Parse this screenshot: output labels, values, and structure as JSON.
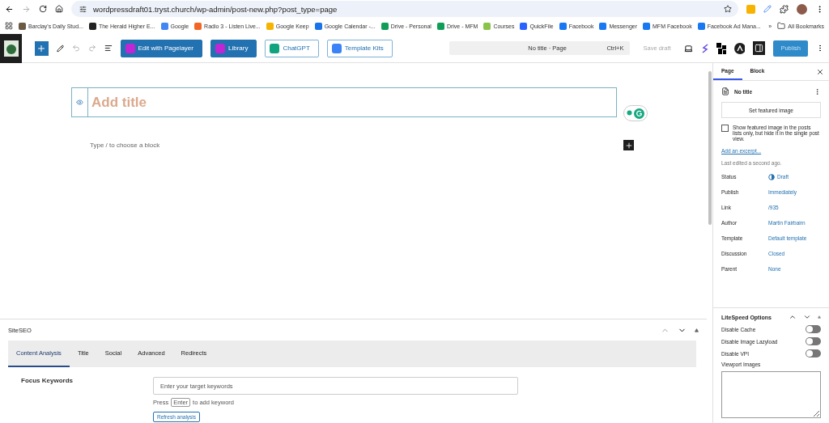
{
  "browser": {
    "url": "wordpressdraft01.tryst.church/wp-admin/post-new.php?post_type=page",
    "bookmarks": [
      {
        "label": "Barclay's Daily Stud...",
        "color": "#6b5a44"
      },
      {
        "label": "The Herald Higher E...",
        "color": "#222222"
      },
      {
        "label": "Google",
        "color": "#4285f4"
      },
      {
        "label": "Radio 3 - Listen Live...",
        "color": "#f26522"
      },
      {
        "label": "Google Keep",
        "color": "#f6b400"
      },
      {
        "label": "Google Calendar -...",
        "color": "#1a73e8"
      },
      {
        "label": "Drive - Personal",
        "color": "#0f9d58"
      },
      {
        "label": "Drive - MFM",
        "color": "#0f9d58"
      },
      {
        "label": "Courses",
        "color": "#8bc34a"
      },
      {
        "label": "QuickFile",
        "color": "#2962ff"
      },
      {
        "label": "Facebook",
        "color": "#1877f2"
      },
      {
        "label": "Messenger",
        "color": "#1877f2"
      },
      {
        "label": "MFM Facebook",
        "color": "#1877f2"
      },
      {
        "label": "Facebook Ad Mana...",
        "color": "#1877f2"
      }
    ],
    "more": "»",
    "all_bookmarks": "All Bookmarks"
  },
  "toolbar": {
    "buttons": [
      {
        "label": "Edit with Pagelayer",
        "kind": "filled"
      },
      {
        "label": "Library",
        "kind": "filled"
      },
      {
        "label": "ChatGPT",
        "kind": "outline"
      },
      {
        "label": "Template Kits",
        "kind": "outline"
      }
    ],
    "command_bar": {
      "title": "No title · Page",
      "shortcut": "Ctrl+K"
    },
    "save_draft": "Save draft",
    "publish": "Publish"
  },
  "editor": {
    "title_placeholder": "Add title",
    "block_placeholder": "Type / to choose a block"
  },
  "siteseo": {
    "title": "SiteSEO",
    "tabs": [
      {
        "label": "Content Analysis",
        "selected": true
      },
      {
        "label": "Title",
        "selected": false
      },
      {
        "label": "Social",
        "selected": false
      },
      {
        "label": "Advanced",
        "selected": false
      },
      {
        "label": "Redirects",
        "selected": false
      }
    ],
    "focus_label": "Focus Keywords",
    "keyword_placeholder": "Enter your target keywords",
    "hint_before": "Press",
    "hint_key": "Enter",
    "hint_after": "to add keyword",
    "refresh_button": "Refresh analysis"
  },
  "sidebar": {
    "tabs": [
      {
        "label": "Page",
        "selected": true
      },
      {
        "label": "Block",
        "selected": false
      }
    ],
    "doc_title": "No title",
    "featured_button": "Set featured image",
    "featured_checkbox": {
      "label": "Show featured image in the posts lists only, but hide it in the single post view.",
      "checked": false
    },
    "excerpt_link": "Add an excerpt...",
    "last_edited": "Last edited a second ago.",
    "rows": [
      {
        "label": "Status",
        "value": "Draft",
        "kind": "status"
      },
      {
        "label": "Publish",
        "value": "Immediately",
        "kind": "link"
      },
      {
        "label": "Link",
        "value": "/935",
        "kind": "link"
      },
      {
        "label": "Author",
        "value": "Martin Fairbairn",
        "kind": "link"
      },
      {
        "label": "Template",
        "value": "Default template",
        "kind": "link"
      },
      {
        "label": "Discussion",
        "value": "Closed",
        "kind": "link"
      },
      {
        "label": "Parent",
        "value": "None",
        "kind": "link"
      }
    ],
    "litespeed": {
      "title": "LiteSpeed Options",
      "toggles": [
        {
          "label": "Disable Cache",
          "on": false
        },
        {
          "label": "Disable Image Lazyload",
          "on": false
        },
        {
          "label": "Disable VPI",
          "on": false
        }
      ],
      "textarea_label": "Viewport Images"
    }
  }
}
